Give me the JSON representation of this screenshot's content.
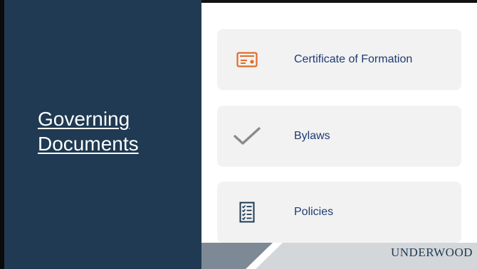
{
  "slide": {
    "title_line1": "Governing",
    "title_line2": "Documents",
    "colors": {
      "panel": "#1f3a52",
      "card": "#f2f2f2",
      "label": "#1f3b73",
      "orange_icon": "#e36c2a",
      "check_icon": "#8a8a8a"
    }
  },
  "cards": [
    {
      "label": "Certificate of Formation",
      "icon": "certificate-icon"
    },
    {
      "label": "Bylaws",
      "icon": "checkmark-icon"
    },
    {
      "label": "Policies",
      "icon": "checklist-icon"
    }
  ],
  "footer": {
    "brand": "UNDERWOOD"
  }
}
